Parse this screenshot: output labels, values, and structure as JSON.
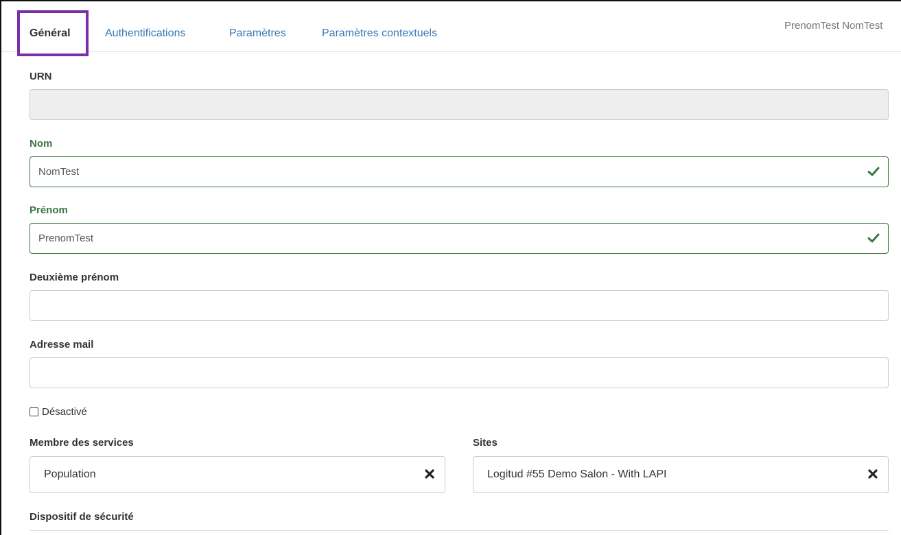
{
  "tabs": [
    {
      "label": "Général",
      "active": true
    },
    {
      "label": "Authentifications",
      "active": false
    },
    {
      "label": "Paramètres",
      "active": false
    },
    {
      "label": "Paramètres contextuels",
      "active": false
    }
  ],
  "header": {
    "user_name": "PrenomTest NomTest"
  },
  "form": {
    "urn": {
      "label": "URN",
      "value": ""
    },
    "nom": {
      "label": "Nom",
      "value": "NomTest",
      "state": "valid"
    },
    "prenom": {
      "label": "Prénom",
      "value": "PrenomTest",
      "state": "valid"
    },
    "deuxieme_prenom": {
      "label": "Deuxième prénom",
      "value": ""
    },
    "adresse_mail": {
      "label": "Adresse mail",
      "value": ""
    },
    "desactive": {
      "label": "Désactivé",
      "checked": false
    },
    "membre_services": {
      "label": "Membre des services",
      "value": "Population"
    },
    "sites": {
      "label": "Sites",
      "value": "Logitud #55 Demo Salon - With LAPI"
    },
    "dispositif_securite": {
      "label": "Dispositif de sécurité"
    }
  },
  "colors": {
    "accent_link": "#337ab7",
    "valid": "#3c763d",
    "highlight": "#7a2ea8"
  }
}
